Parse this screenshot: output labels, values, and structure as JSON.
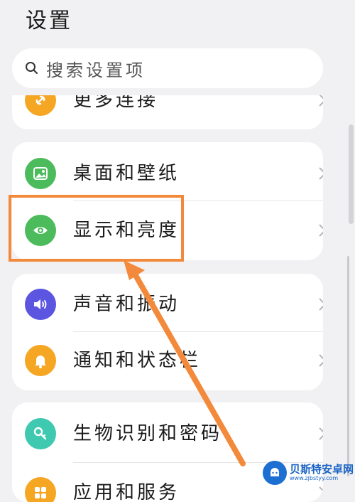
{
  "header": {
    "title": "设置"
  },
  "search": {
    "placeholder": "搜索设置项"
  },
  "colors": {
    "highlight": "#f38a3b",
    "green": "#4cbb5c",
    "purple": "#5b55e0",
    "orange": "#f5a623",
    "teal": "#3ec9b0"
  },
  "groups": [
    {
      "items": [
        {
          "label": "更多连接",
          "icon": "link-icon"
        }
      ]
    },
    {
      "items": [
        {
          "label": "桌面和壁纸",
          "icon": "wallpaper-icon"
        },
        {
          "label": "显示和亮度",
          "icon": "eye-icon"
        }
      ]
    },
    {
      "items": [
        {
          "label": "声音和振动",
          "icon": "speaker-icon"
        },
        {
          "label": "通知和状态栏",
          "icon": "bell-icon"
        }
      ]
    },
    {
      "items": [
        {
          "label": "生物识别和密码",
          "icon": "key-icon"
        },
        {
          "label": "应用和服务",
          "icon": "apps-icon"
        }
      ]
    }
  ],
  "watermark": {
    "name": "贝斯特安卓网",
    "url": "www.zjbstyy.com"
  }
}
